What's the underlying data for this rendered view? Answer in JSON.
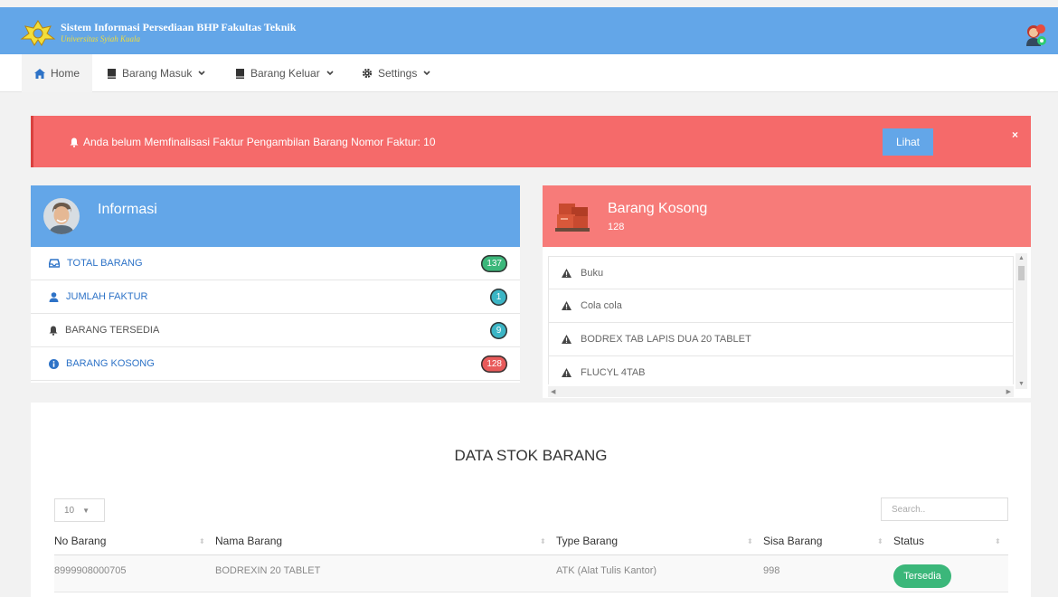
{
  "header": {
    "title": "Sistem Informasi Persediaan BHP Fakultas Teknik",
    "subtitle": "Universitas Syiah Kuala"
  },
  "nav": [
    {
      "label": "Home",
      "icon": "home-icon"
    },
    {
      "label": "Barang Masuk",
      "icon": "book-icon"
    },
    {
      "label": "Barang Keluar",
      "icon": "book-icon"
    },
    {
      "label": "Settings",
      "icon": "gear-icon"
    }
  ],
  "alert": {
    "text": "Anda belum Memfinalisasi Faktur Pengambilan Barang Nomor Faktur: 10",
    "button": "Lihat",
    "close": "×"
  },
  "info": {
    "title": "Informasi",
    "rows": [
      {
        "label": "TOTAL BARANG",
        "value": "137",
        "color": "#3bb77a"
      },
      {
        "label": "JUMLAH FAKTUR",
        "value": "1",
        "color": "#3bb5c5"
      },
      {
        "label": "BARANG TERSEDIA",
        "value": "9",
        "color": "#3bb5c5"
      },
      {
        "label": "BARANG KOSONG",
        "value": "128",
        "color": "#e85a5a"
      }
    ]
  },
  "empty": {
    "title": "Barang Kosong",
    "count": "128",
    "items": [
      "Buku",
      "Cola cola",
      "BODREX TAB LAPIS DUA 20 TABLET",
      "FLUCYL 4TAB"
    ]
  },
  "stock": {
    "title": "DATA STOK BARANG",
    "length": "10",
    "search_placeholder": "Search..",
    "columns": [
      "No Barang",
      "Nama Barang",
      "Type Barang",
      "Sisa Barang",
      "Status"
    ],
    "rows": [
      {
        "no": "8999908000705",
        "nama": "BODREXIN 20 TABLET",
        "type": "ATK (Alat Tulis Kantor)",
        "sisa": "998",
        "status": "Tersedia"
      }
    ]
  },
  "colors": {
    "primary": "#63a6e8",
    "danger": "#f56a6a",
    "success": "#3bb77a"
  }
}
